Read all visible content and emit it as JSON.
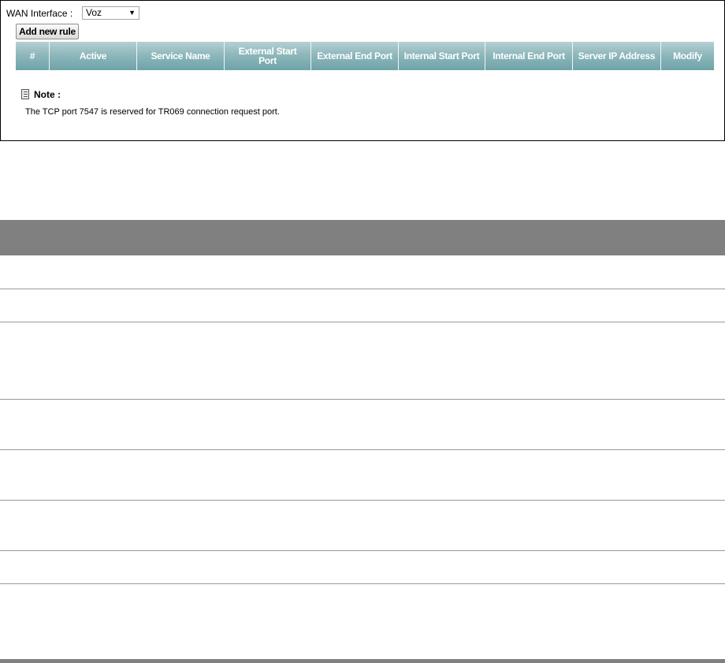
{
  "wan": {
    "label": "WAN Interface :",
    "selected": "Voz"
  },
  "add_button": "Add new rule",
  "table": {
    "columns": [
      "#",
      "Active",
      "Service Name",
      "External Start Port",
      "External End Port",
      "Internal Start Port",
      "Internal End Port",
      "Server IP Address",
      "Modify"
    ]
  },
  "note": {
    "title": "Note :",
    "text": "The TCP port 7547 is reserved for TR069 connection request port."
  },
  "colors": {
    "header_teal": "#8fb8bc",
    "doc_header_gray": "#808080"
  }
}
